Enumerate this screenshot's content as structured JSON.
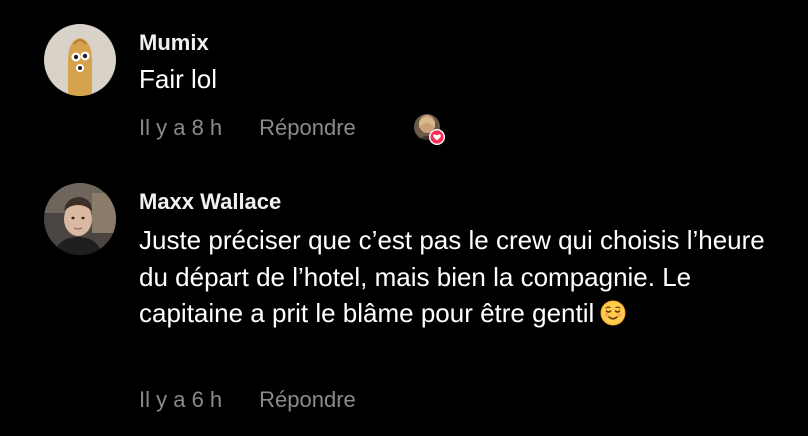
{
  "comments": [
    {
      "username": "Mumix",
      "text": "Fair lol",
      "time": "Il y a 8 h",
      "reply_label": "Répondre",
      "avatar_icon": "cartoon-avatar-icon",
      "liked_by_creator": true,
      "heart_color": "#fe2c55"
    },
    {
      "username": "Maxx Wallace",
      "text": "Juste préciser que c’est pas le crew qui choisis l’heure du départ de l’hotel, mais bien la compagnie. Le capitaine a prit le blâme pour être gentil",
      "emoji": "relieved-face-emoji",
      "time": "Il y a 6 h",
      "reply_label": "Répondre",
      "avatar_icon": "user-photo-avatar"
    }
  ],
  "colors": {
    "background": "#000000",
    "text": "#ffffff",
    "meta": "#8a8a8a"
  }
}
